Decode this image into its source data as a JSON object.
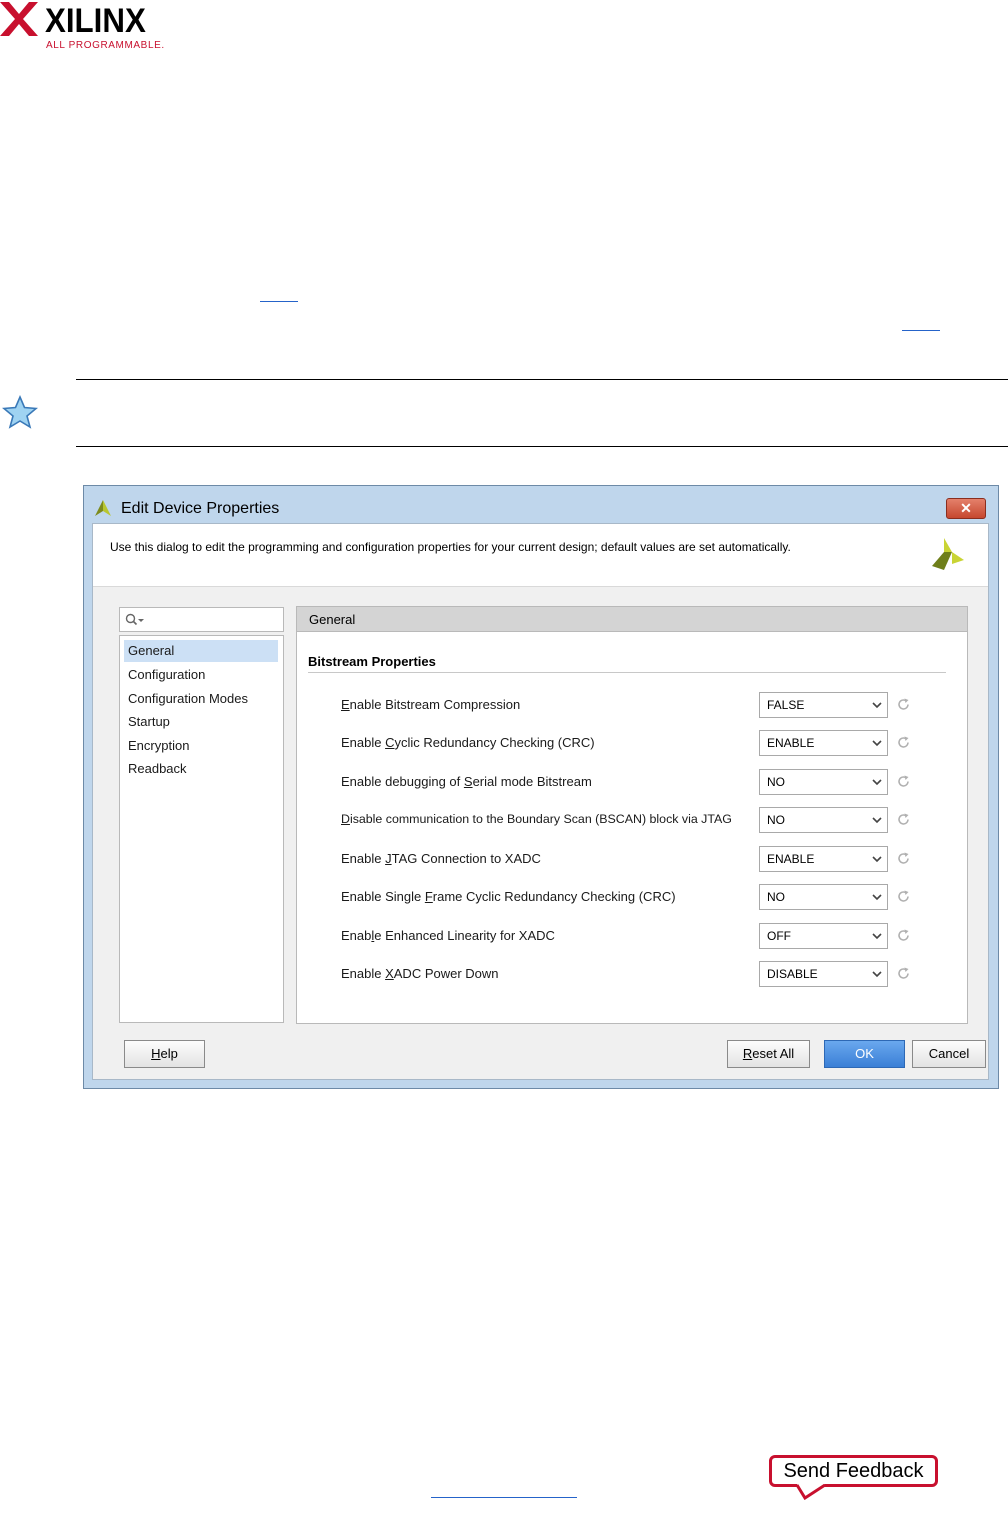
{
  "header": {
    "brand": "XILINX",
    "tagline": "ALL PROGRAMMABLE."
  },
  "dialog": {
    "title": "Edit Device Properties",
    "close_label": "✕",
    "description": "Use this dialog to edit the programming and configuration properties for your current design; default values are set automatically.",
    "search_placeholder": "",
    "tree_items": [
      {
        "label": "General",
        "selected": true
      },
      {
        "label": "Configuration",
        "selected": false
      },
      {
        "label": "Configuration Modes",
        "selected": false
      },
      {
        "label": "Startup",
        "selected": false
      },
      {
        "label": "Encryption",
        "selected": false
      },
      {
        "label": "Readback",
        "selected": false
      }
    ],
    "panel_title": "General",
    "section_title": "Bitstream Properties",
    "properties": [
      {
        "pre": "",
        "u": "E",
        "post": "nable Bitstream Compression",
        "value": "FALSE"
      },
      {
        "pre": "Enable ",
        "u": "C",
        "post": "yclic Redundancy Checking (CRC)",
        "value": "ENABLE"
      },
      {
        "pre": "Enable debugging of ",
        "u": "S",
        "post": "erial mode Bitstream",
        "value": "NO"
      },
      {
        "pre": "",
        "u": "D",
        "post": "isable communication to the Boundary Scan (BSCAN) block via JTAG",
        "value": "NO"
      },
      {
        "pre": "Enable ",
        "u": "J",
        "post": "TAG Connection to XADC",
        "value": "ENABLE"
      },
      {
        "pre": "Enable Single ",
        "u": "F",
        "post": "rame Cyclic Redundancy Checking (CRC)",
        "value": "NO"
      },
      {
        "pre": "Enab",
        "u": "l",
        "post": "e Enhanced Linearity for XADC",
        "value": "OFF"
      },
      {
        "pre": "Enable ",
        "u": "X",
        "post": "ADC Power Down",
        "value": "DISABLE"
      }
    ],
    "buttons": {
      "help": {
        "u": "H",
        "post": "elp"
      },
      "reset_all": {
        "u": "R",
        "post": "eset All"
      },
      "ok": "OK",
      "cancel": "Cancel"
    }
  },
  "feedback": "Send Feedback",
  "colors": {
    "accent_red": "#c8102e",
    "selection": "#cce0f5",
    "ok_button": "#3a7fd6"
  }
}
